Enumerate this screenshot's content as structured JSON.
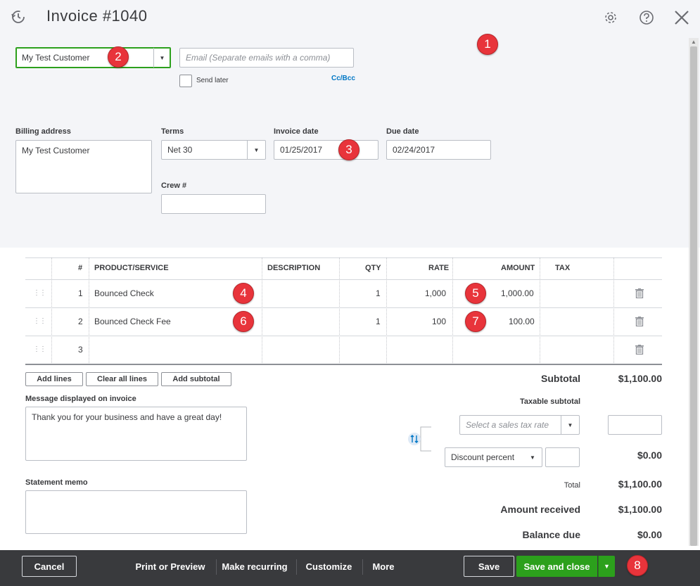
{
  "header": {
    "title": "Invoice #1040",
    "icons": [
      "history-icon",
      "gear-icon",
      "help-icon",
      "close-icon"
    ]
  },
  "customer": {
    "value": "My Test Customer"
  },
  "email": {
    "placeholder": "Email (Separate emails with a comma)",
    "value": ""
  },
  "send_later_label": "Send later",
  "ccbcc_label": "Cc/Bcc",
  "billing": {
    "label": "Billing address",
    "value": "My Test Customer"
  },
  "terms": {
    "label": "Terms",
    "value": "Net 30"
  },
  "invoice_date": {
    "label": "Invoice date",
    "value": "01/25/2017"
  },
  "due_date": {
    "label": "Due date",
    "value": "02/24/2017"
  },
  "crew": {
    "label": "Crew #",
    "value": ""
  },
  "table": {
    "columns": [
      "#",
      "PRODUCT/SERVICE",
      "DESCRIPTION",
      "QTY",
      "RATE",
      "AMOUNT",
      "TAX"
    ],
    "rows": [
      {
        "num": "1",
        "product": "Bounced Check",
        "description": "",
        "qty": "1",
        "rate": "1,000",
        "amount": "1,000.00",
        "tax": ""
      },
      {
        "num": "2",
        "product": "Bounced Check Fee",
        "description": "",
        "qty": "1",
        "rate": "100",
        "amount": "100.00",
        "tax": ""
      },
      {
        "num": "3",
        "product": "",
        "description": "",
        "qty": "",
        "rate": "",
        "amount": "",
        "tax": ""
      }
    ]
  },
  "line_buttons": {
    "add_lines": "Add lines",
    "clear_all": "Clear all lines",
    "add_subtotal": "Add subtotal"
  },
  "message": {
    "label": "Message displayed on invoice",
    "value": "Thank you for your business and have a great day!"
  },
  "memo": {
    "label": "Statement memo",
    "value": ""
  },
  "totals": {
    "subtotal_label": "Subtotal",
    "subtotal_value": "$1,100.00",
    "taxable_label": "Taxable subtotal",
    "tax_rate_placeholder": "Select a sales tax rate",
    "discount_type": "Discount percent",
    "discount_value": "$0.00",
    "total_label": "Total",
    "total_value": "$1,100.00",
    "received_label": "Amount received",
    "received_value": "$1,100.00",
    "balance_label": "Balance due",
    "balance_value": "$0.00"
  },
  "footer": {
    "cancel": "Cancel",
    "print": "Print or Preview",
    "recurring": "Make recurring",
    "customize": "Customize",
    "more": "More",
    "save": "Save",
    "save_close": "Save and close"
  },
  "badges": [
    "1",
    "2",
    "3",
    "4",
    "5",
    "6",
    "7",
    "8"
  ],
  "colors": {
    "accent_green": "#2ca01c",
    "badge_red": "#e8343b",
    "footer_bg": "#393a3d",
    "link_blue": "#0077c5"
  }
}
